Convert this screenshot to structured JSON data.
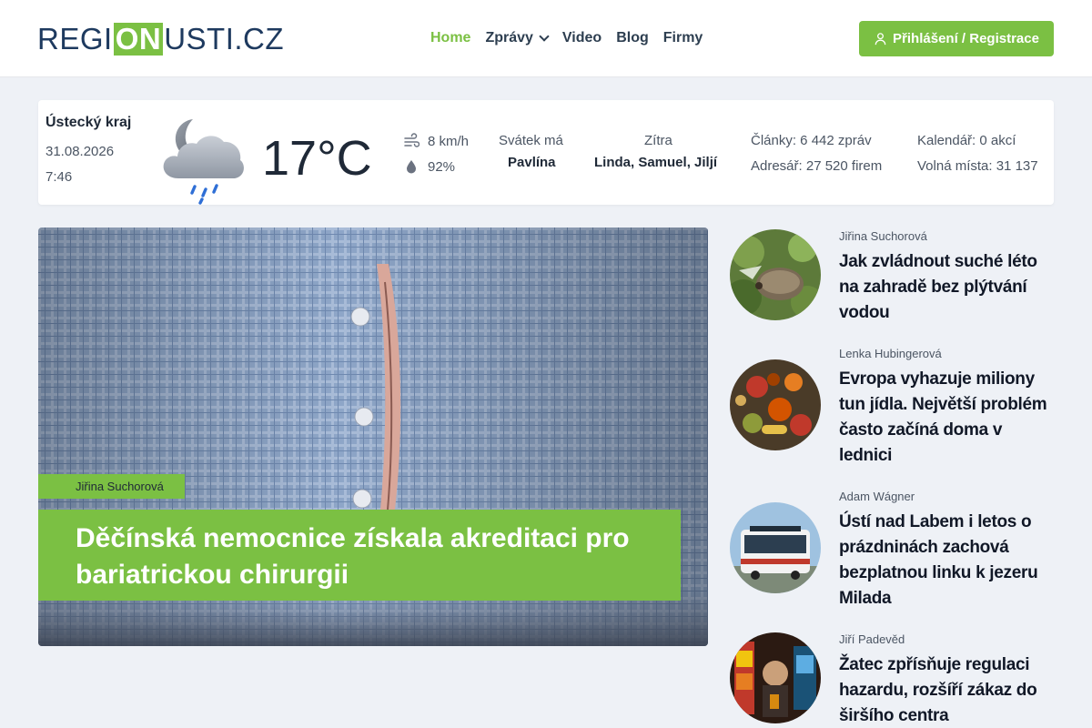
{
  "header": {
    "logo": {
      "left": "REGI",
      "mid": "ON",
      "right": "USTI.CZ"
    },
    "nav": [
      {
        "label": "Home",
        "active": true
      },
      {
        "label": "Zprávy",
        "has_dropdown": true
      },
      {
        "label": "Video"
      },
      {
        "label": "Blog"
      },
      {
        "label": "Firmy"
      }
    ],
    "login_label": "Přihlášení / Registrace",
    "accent_color": "#7bc043",
    "brand_dark": "#1e3a5f"
  },
  "weather": {
    "region": "Ústecký kraj",
    "date": "31.08.2026",
    "time": "7:46",
    "icon": "night-cloud-rain-icon",
    "temperature": "17°C",
    "wind": "8 km/h",
    "humidity": "92%",
    "nameday_label": "Svátek má",
    "nameday_name": "Pavlína",
    "tomorrow_label": "Zítra",
    "tomorrow_names": "Linda, Samuel, Jiljí",
    "articles": "Články: 6 442 zpráv",
    "directory": "Adresář: 27 520 firem",
    "calendar": "Kalendář: 0 akcí",
    "jobs": "Volná místa: 31 137"
  },
  "featured": {
    "author": "Jiřina Suchorová",
    "title": "Děčínská nemocnice získala akreditaci pro bariatrickou chirurgii"
  },
  "side_articles": [
    {
      "author": "Jiřina Suchorová",
      "title": "Jak zvládnout suché léto na zahradě bez plýtvání vodou",
      "thumb": "hedgehog-garden"
    },
    {
      "author": "Lenka Hubingerová",
      "title": "Evropa vyhazuje miliony tun jídla. Největší problém často začíná doma v lednici",
      "thumb": "food-waste"
    },
    {
      "author": "Adam Wágner",
      "title": "Ústí nad Labem i letos o prázdninách zachová bezplatnou linku k jezeru Milada",
      "thumb": "city-bus"
    },
    {
      "author": "Jiří Padevěd",
      "title": "Žatec zpřísňuje regulaci hazardu, rozšíří zákaz do širšího centra",
      "thumb": "slot-machine"
    }
  ]
}
